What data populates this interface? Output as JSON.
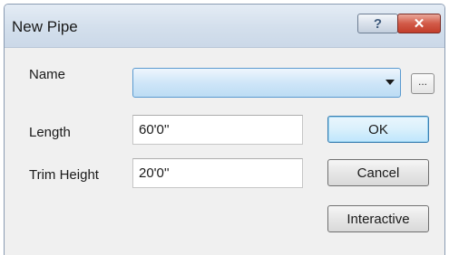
{
  "dialog": {
    "title": "New Pipe",
    "help_label": "?",
    "close_label": "✕"
  },
  "fields": {
    "name_label": "Name",
    "name_value": "",
    "browse_label": "...",
    "length_label": "Length",
    "length_value": "60'0''",
    "trim_height_label": "Trim Height",
    "trim_height_value": "20'0''"
  },
  "buttons": {
    "ok": "OK",
    "cancel": "Cancel",
    "interactive": "Interactive"
  }
}
